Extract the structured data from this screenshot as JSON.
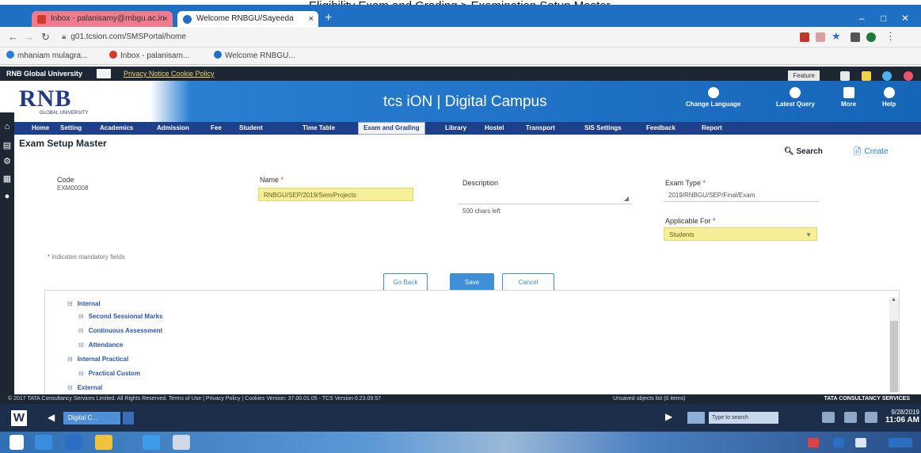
{
  "caption": "Eligibility Exam and Grading > Examination Setup Master",
  "browser": {
    "tabs": [
      {
        "label": "Inbox - palanisamy@rnbgu.ac.in"
      },
      {
        "label": "Welcome RNBGU/Sayeeda"
      }
    ],
    "new_tab": "+",
    "url": "g01.tcsion.com/SMSPortal/home"
  },
  "bookmarks": [
    {
      "label": "mhaniam mulagra...",
      "color": "#2a7fd3"
    },
    {
      "label": "Inbox - palanisam...",
      "color": "#d33a2c"
    },
    {
      "label": "Welcome RNBGU...",
      "color": "#1f6fc4"
    }
  ],
  "portal": {
    "university": "RNB Global University",
    "privacy": "Privacy Notice  Cookie Policy",
    "feature_select": "Feature",
    "brand": "tcs iON | Digital Campus",
    "logo": "RNB",
    "logo_sub": "GLOBAL UNIVERSITY",
    "header_items": [
      {
        "label": "Change Language"
      },
      {
        "label": "Latest Query"
      },
      {
        "label": "More"
      },
      {
        "label": "Help"
      }
    ],
    "menu": [
      {
        "label": "Home"
      },
      {
        "label": "Setting"
      },
      {
        "label": "Academics"
      },
      {
        "label": "Admission"
      },
      {
        "label": "Fee"
      },
      {
        "label": "Student"
      },
      {
        "label": "Time Table"
      },
      {
        "label": "Exam and Grading"
      },
      {
        "label": "Library"
      },
      {
        "label": "Hostel"
      },
      {
        "label": "Transport"
      },
      {
        "label": "SIS Settings"
      },
      {
        "label": "Feedback"
      },
      {
        "label": "Report"
      }
    ]
  },
  "page": {
    "title": "Exam Setup Master",
    "search": "Search",
    "create": "Create",
    "form": {
      "code_label": "Code",
      "code_value": "EXM00008",
      "name_label": "Name",
      "name_value": "RNBGU/SEP/2019/Sem/Projects",
      "description_label": "Description",
      "description_counter": "500 chars left",
      "exam_type_label": "Exam Type",
      "exam_type_value": "2019/RNBGU/SEP/Final/Exam",
      "applicable_for_label": "Applicable For",
      "applicable_for_value": "Students",
      "required_mark": "*"
    },
    "mandatory_note": "* indicates mandatory fields",
    "buttons": {
      "go_back": "Go Back",
      "save": "Save",
      "cancel": "Cancel"
    },
    "tree": [
      {
        "label": "Internal",
        "level": 1
      },
      {
        "label": "Second Sessional Marks",
        "level": 2
      },
      {
        "label": "Continuous Assessment",
        "level": 2
      },
      {
        "label": "Attendance",
        "level": 2
      },
      {
        "label": "Internal Practical",
        "level": 1
      },
      {
        "label": "Practical Custom",
        "level": 2
      },
      {
        "label": "External",
        "level": 1
      }
    ]
  },
  "footer": {
    "left": "© 2017 TATA Consultancy Services Limited. All Rights Reserved.   Terms of Use | Privacy Policy | Cookies  Version: 37.00.01.05 - TCS Version 0.23.09.57",
    "mid": "Unsaved objects list (0 items)",
    "right": "TATA CONSULTANCY SERVICES"
  },
  "taskbar": {
    "digital_tab": "Digital C...",
    "search_placeholder": "Type to search",
    "clock_date": "9/28/2019",
    "clock_time": "11:06 AM"
  },
  "colors": {
    "menu": "#1e3f8a",
    "header_gradient": "#1565b8",
    "highlight_field": "#f6ef9a",
    "primary_button": "#3c8fd8"
  }
}
